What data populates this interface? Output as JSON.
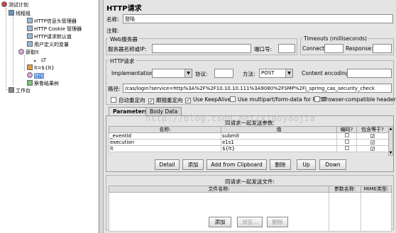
{
  "tree": {
    "items": [
      {
        "label": "测试计划",
        "icon": "test-plan-icon"
      },
      {
        "label": "线程组",
        "icon": "thread-group-icon"
      },
      {
        "label": "HTTP信息头管理器",
        "icon": "config-element-icon"
      },
      {
        "label": "HTTP Cookie 管理器",
        "icon": "config-element-icon"
      },
      {
        "label": "HTTP请求默认值",
        "icon": "config-element-icon"
      },
      {
        "label": "用户定义的变量",
        "icon": "config-element-icon"
      },
      {
        "label": "获取lt",
        "icon": "sampler-icon"
      },
      {
        "label": "LT",
        "icon": "regex-extractor-icon"
      },
      {
        "label": "lt=${lt}",
        "icon": "debug-sampler-icon"
      },
      {
        "label": "登陆",
        "icon": "sampler-icon"
      },
      {
        "label": "察看结果树",
        "icon": "listener-icon"
      },
      {
        "label": "工作台",
        "icon": "workbench-icon"
      }
    ]
  },
  "panel": {
    "title": "HTTP请求",
    "name_label": "名称:",
    "name_value": "登陆",
    "comments_label": "注释:",
    "web_server": {
      "title": "Web服务器",
      "server_label": "服务器名称或IP:",
      "server_value": "",
      "port_label": "端口号:",
      "port_value": ""
    },
    "timeouts": {
      "title": "Timeouts (milliseconds)",
      "connect_label": "Connect:",
      "connect_value": "",
      "response_label": "Response:",
      "response_value": ""
    },
    "http_request": {
      "title": "HTTP请求",
      "implementation_label": "Implementation:",
      "implementation_value": "",
      "protocol_label": "协议:",
      "protocol_value": "",
      "method_label": "方法:",
      "method_value": "POST",
      "encoding_label": "Content encoding:",
      "encoding_value": "",
      "path_label": "路径:",
      "path_value": "/cas/login?service=http%3A%2F%2F10.10.10.111%3A9080%2FSMP%2Fj_spring_cas_security_check"
    },
    "options": [
      {
        "label": "自动重定向",
        "checked": false
      },
      {
        "label": "跟随重定向",
        "checked": true
      },
      {
        "label": "Use KeepAlive",
        "checked": true
      },
      {
        "label": "Use multipart/form-data for POST",
        "checked": false
      },
      {
        "label": "Browser-compatible headers",
        "checked": false
      }
    ],
    "tabs": [
      {
        "label": "Parameters",
        "active": true
      },
      {
        "label": "Body Data",
        "active": false
      }
    ],
    "params": {
      "caption": "同请求一起发送参数:",
      "headers": [
        "名称:",
        "值",
        "编码?",
        "包含等于?"
      ],
      "rows": [
        {
          "name": "_eventId",
          "value": "submit",
          "encode": false,
          "include_equals": true
        },
        {
          "name": "execution",
          "value": "e1s1",
          "encode": false,
          "include_equals": true
        },
        {
          "name": "lt",
          "value": "${lt}",
          "encode": false,
          "include_equals": true
        }
      ]
    },
    "param_buttons": [
      "Detail",
      "添加",
      "Add from Clipboard",
      "删除",
      "Up",
      "Down"
    ],
    "files": {
      "caption": "同请求一起发送文件:",
      "headers": [
        "文件名称:",
        "参数名称:",
        "MIME类型:"
      ]
    },
    "file_buttons": [
      "添加",
      "浏览...",
      "删除"
    ]
  },
  "watermark": "http://blog.csdn.net/xiaoyaojia"
}
